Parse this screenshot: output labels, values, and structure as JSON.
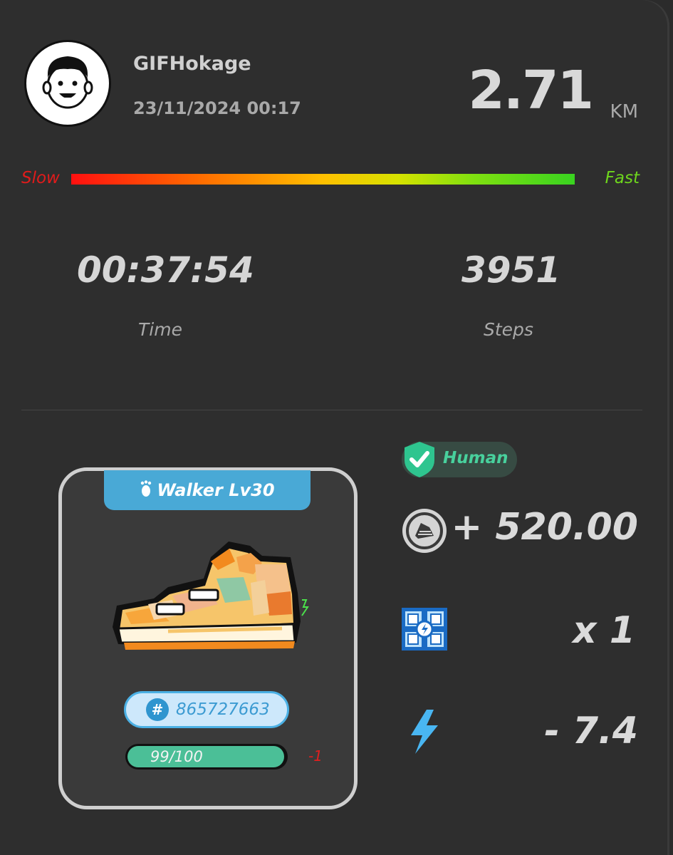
{
  "user": {
    "name": "GIFHokage",
    "datetime": "23/11/2024 00:17"
  },
  "summary": {
    "distance": "2.71",
    "unit": "KM"
  },
  "speed": {
    "slow_label": "Slow",
    "fast_label": "Fast"
  },
  "stats": [
    {
      "value": "00:37:54",
      "label": "Time"
    },
    {
      "value": "3951",
      "label": "Steps"
    }
  ],
  "sneaker": {
    "level_label": "Walker Lv30",
    "id": "865727663",
    "hash_symbol": "#",
    "durability_text": "99/100",
    "durability_value": 99,
    "durability_max": 100,
    "durability_delta": "-1"
  },
  "results": {
    "human_label": "Human",
    "reward": "+ 520.00",
    "mystery_box": "x 1",
    "energy": "- 7.4"
  },
  "colors": {
    "accent_blue": "#49a9d6",
    "human_green": "#48d19d",
    "slow_red": "#e01b1b",
    "fast_green": "#6ed61d",
    "delta_red": "#e11f1f"
  }
}
